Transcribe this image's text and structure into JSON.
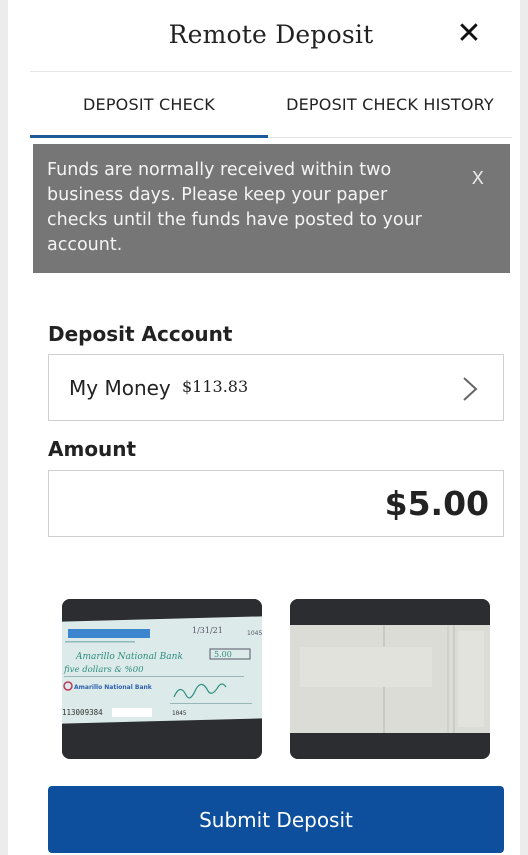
{
  "header": {
    "title": "Remote Deposit",
    "close_label": "✕"
  },
  "tabs": [
    {
      "label": "DEPOSIT CHECK",
      "active": true
    },
    {
      "label": "DEPOSIT CHECK HISTORY",
      "active": false
    }
  ],
  "notice": {
    "message": "Funds are normally received within two business days. Please keep your paper checks until the funds have posted to your account.",
    "dismiss_label": "X"
  },
  "deposit_account": {
    "label": "Deposit Account",
    "name": "My Money",
    "balance": "$113.83"
  },
  "amount": {
    "label": "Amount",
    "value": "$5.00"
  },
  "images": {
    "front": {
      "bank_line": "Amarillo National Bank",
      "amount_box": "5.00",
      "written_line": "five dollars & %00",
      "bank_name": "Amarillo National Bank",
      "micr": "113009384",
      "check_no": "1045",
      "date": "1/31/21"
    }
  },
  "submit": {
    "label": "Submit Deposit"
  },
  "colors": {
    "accent": "#1f5a98",
    "button": "#0d4f9c",
    "notice_bg": "#767676"
  }
}
